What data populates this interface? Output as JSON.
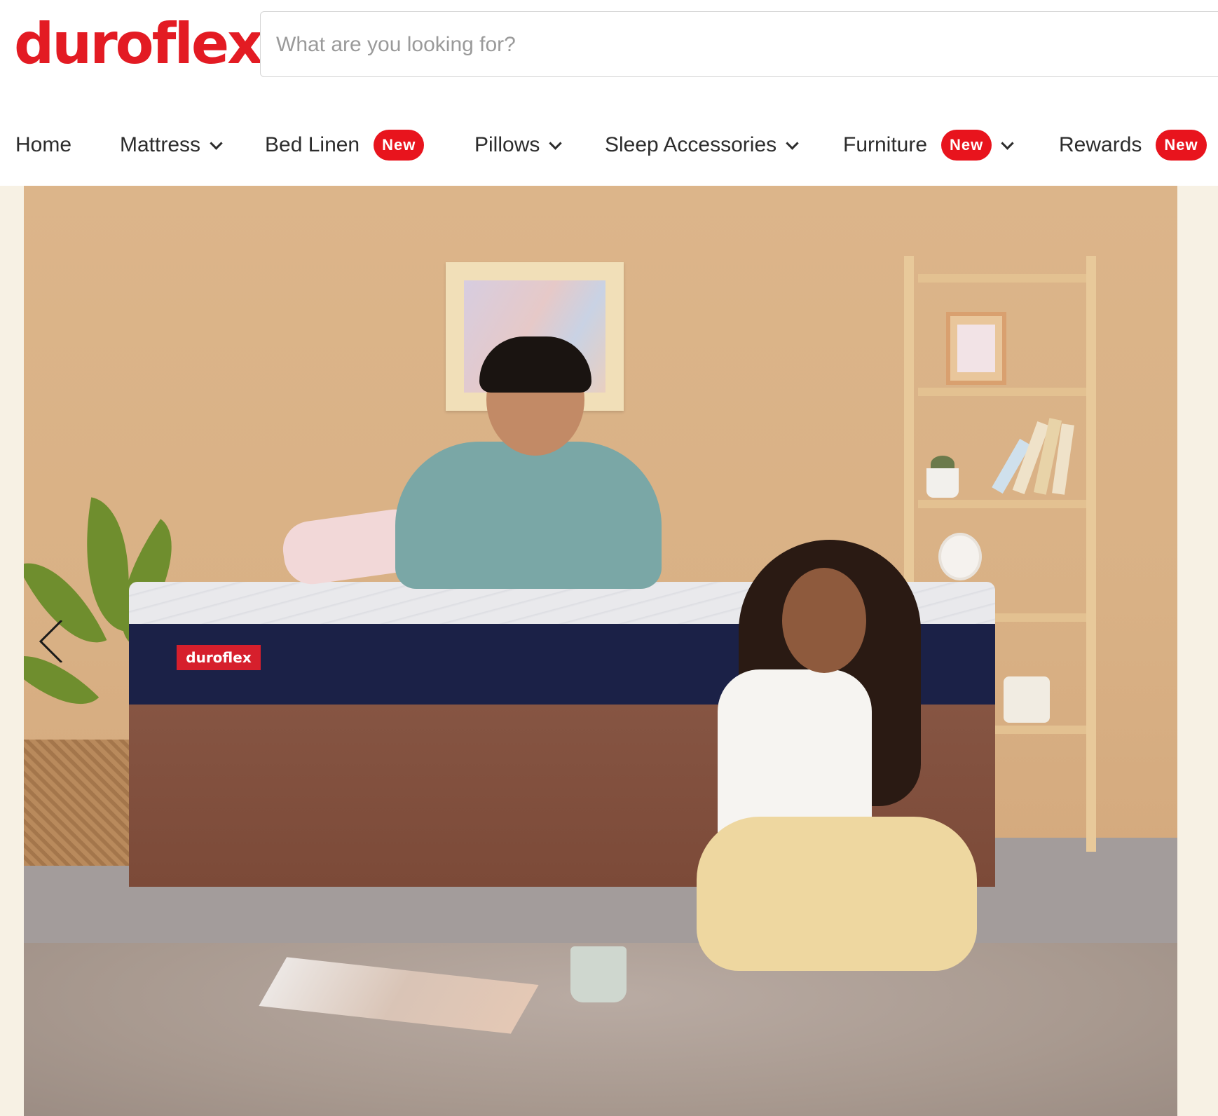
{
  "brand": {
    "logo_text": "duroflex",
    "color": "#e31b23"
  },
  "search": {
    "placeholder": "What are you looking for?"
  },
  "nav": {
    "items": [
      {
        "label": "Home"
      },
      {
        "label": "Mattress",
        "icon": "chevron-down-icon"
      },
      {
        "label": "Bed Linen",
        "badge": "New"
      },
      {
        "label": "Pillows",
        "icon": "chevron-down-icon"
      },
      {
        "label": "Sleep Accessories",
        "icon": "chevron-down-icon"
      },
      {
        "label": "Furniture",
        "badge": "New",
        "icon": "chevron-down-icon"
      },
      {
        "label": "Rewards",
        "badge": "New"
      }
    ],
    "badge_color": "#e8141d"
  },
  "hero": {
    "mattress_logo_text": "duroflex",
    "prev_icon": "chevron-left-icon"
  }
}
